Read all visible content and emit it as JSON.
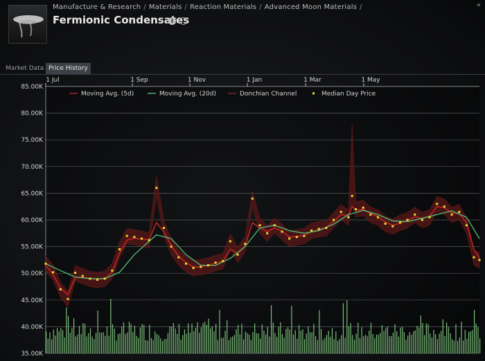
{
  "breadcrumb": [
    "Manufacture & Research",
    "Materials",
    "Reaction Materials",
    "Advanced Moon Materials"
  ],
  "item": {
    "title": "Fermionic Condensates"
  },
  "tabs": [
    {
      "label": "Market Data",
      "active": false
    },
    {
      "label": "Price History",
      "active": true
    }
  ],
  "icons": {
    "info": "info-icon",
    "show_info": "eye-icon",
    "collapse": "collapse-icon"
  },
  "colors": {
    "ma5": "#c02424",
    "ma20": "#55c07a",
    "donchian": "#5a1717",
    "median": "#e6df2e",
    "volume": "#8fe08f"
  },
  "chart_data": {
    "type": "line",
    "x_ticks": [
      "1 Jul",
      "1 Sep",
      "1 Nov",
      "1 Jan",
      "1 Mar",
      "1 May"
    ],
    "y_ticks": [
      "85.00K",
      "80.00K",
      "75.00K",
      "70.00K",
      "65.00K",
      "60.00K",
      "55.00K",
      "50.00K",
      "45.00K",
      "40.00K",
      "35.00K"
    ],
    "ylim": [
      35000,
      85000
    ],
    "legend": [
      "Moving Avg. (5d)",
      "Moving Avg. (20d)",
      "Donchian Channel",
      "Median Day Price"
    ],
    "legend_position": "top",
    "grid": true,
    "series": [
      {
        "name": "Median Day Price",
        "type": "scatter",
        "values": [
          [
            0,
            51800
          ],
          [
            8,
            50200
          ],
          [
            16,
            47000
          ],
          [
            24,
            45200
          ],
          [
            32,
            50100
          ],
          [
            40,
            49500
          ],
          [
            48,
            49000
          ],
          [
            56,
            48800
          ],
          [
            64,
            49000
          ],
          [
            72,
            50500
          ],
          [
            80,
            54500
          ],
          [
            88,
            57000
          ],
          [
            96,
            56800
          ],
          [
            104,
            56500
          ],
          [
            112,
            56200
          ],
          [
            120,
            66000
          ],
          [
            128,
            58500
          ],
          [
            136,
            55000
          ],
          [
            144,
            53000
          ],
          [
            152,
            51800
          ],
          [
            160,
            51000
          ],
          [
            168,
            51200
          ],
          [
            176,
            51500
          ],
          [
            184,
            52000
          ],
          [
            192,
            52300
          ],
          [
            200,
            56000
          ],
          [
            208,
            53500
          ],
          [
            216,
            55500
          ],
          [
            224,
            64000
          ],
          [
            232,
            59000
          ],
          [
            240,
            57500
          ],
          [
            248,
            59000
          ],
          [
            256,
            57800
          ],
          [
            264,
            56500
          ],
          [
            272,
            56800
          ],
          [
            280,
            57000
          ],
          [
            288,
            58000
          ],
          [
            296,
            58300
          ],
          [
            304,
            58500
          ],
          [
            312,
            60000
          ],
          [
            320,
            61500
          ],
          [
            328,
            60500
          ],
          [
            332,
            64500
          ],
          [
            336,
            62000
          ],
          [
            344,
            62300
          ],
          [
            352,
            61000
          ],
          [
            360,
            60500
          ],
          [
            368,
            59300
          ],
          [
            376,
            58800
          ],
          [
            384,
            59500
          ],
          [
            392,
            60000
          ],
          [
            400,
            61000
          ],
          [
            408,
            60000
          ],
          [
            416,
            60500
          ],
          [
            424,
            63000
          ],
          [
            432,
            62500
          ],
          [
            440,
            61000
          ],
          [
            448,
            61500
          ],
          [
            456,
            59000
          ],
          [
            464,
            53000
          ],
          [
            470,
            52500
          ]
        ]
      },
      {
        "name": "Moving Avg. (5d)",
        "values": [
          [
            0,
            51500
          ],
          [
            8,
            49800
          ],
          [
            16,
            47200
          ],
          [
            24,
            46000
          ],
          [
            32,
            49200
          ],
          [
            40,
            49300
          ],
          [
            48,
            49000
          ],
          [
            56,
            48900
          ],
          [
            64,
            49000
          ],
          [
            72,
            50200
          ],
          [
            80,
            53800
          ],
          [
            88,
            56200
          ],
          [
            96,
            56600
          ],
          [
            104,
            56400
          ],
          [
            112,
            56300
          ],
          [
            120,
            59500
          ],
          [
            128,
            57800
          ],
          [
            136,
            55200
          ],
          [
            144,
            53200
          ],
          [
            152,
            52000
          ],
          [
            160,
            51200
          ],
          [
            168,
            51200
          ],
          [
            176,
            51500
          ],
          [
            184,
            51900
          ],
          [
            192,
            52300
          ],
          [
            200,
            54500
          ],
          [
            208,
            53800
          ],
          [
            216,
            55000
          ],
          [
            224,
            59500
          ],
          [
            232,
            58500
          ],
          [
            240,
            57800
          ],
          [
            248,
            58500
          ],
          [
            256,
            57900
          ],
          [
            264,
            56800
          ],
          [
            272,
            56900
          ],
          [
            280,
            57100
          ],
          [
            288,
            57800
          ],
          [
            296,
            58200
          ],
          [
            304,
            58600
          ],
          [
            312,
            59700
          ],
          [
            320,
            61000
          ],
          [
            328,
            60800
          ],
          [
            332,
            62500
          ],
          [
            336,
            61800
          ],
          [
            344,
            62000
          ],
          [
            352,
            61200
          ],
          [
            360,
            60600
          ],
          [
            368,
            59600
          ],
          [
            376,
            59000
          ],
          [
            384,
            59400
          ],
          [
            392,
            59900
          ],
          [
            400,
            60600
          ],
          [
            408,
            60300
          ],
          [
            416,
            60700
          ],
          [
            424,
            62500
          ],
          [
            432,
            62300
          ],
          [
            440,
            61300
          ],
          [
            448,
            61200
          ],
          [
            456,
            59500
          ],
          [
            464,
            54500
          ],
          [
            470,
            52800
          ]
        ]
      },
      {
        "name": "Moving Avg. (20d)",
        "values": [
          [
            0,
            51800
          ],
          [
            16,
            50500
          ],
          [
            32,
            49300
          ],
          [
            48,
            49000
          ],
          [
            64,
            49000
          ],
          [
            80,
            50200
          ],
          [
            96,
            53500
          ],
          [
            112,
            56000
          ],
          [
            120,
            57200
          ],
          [
            136,
            56500
          ],
          [
            152,
            53500
          ],
          [
            168,
            51500
          ],
          [
            184,
            51500
          ],
          [
            200,
            52800
          ],
          [
            216,
            55000
          ],
          [
            232,
            58500
          ],
          [
            248,
            59000
          ],
          [
            264,
            58000
          ],
          [
            280,
            57500
          ],
          [
            296,
            58000
          ],
          [
            312,
            59200
          ],
          [
            328,
            61000
          ],
          [
            344,
            61800
          ],
          [
            360,
            61000
          ],
          [
            376,
            59800
          ],
          [
            392,
            59700
          ],
          [
            408,
            60300
          ],
          [
            424,
            61000
          ],
          [
            440,
            61700
          ],
          [
            456,
            60500
          ],
          [
            470,
            56500
          ]
        ]
      },
      {
        "name": "Volume",
        "type": "bar",
        "note": "unlabeled volume bars at bottom of chart"
      }
    ]
  }
}
